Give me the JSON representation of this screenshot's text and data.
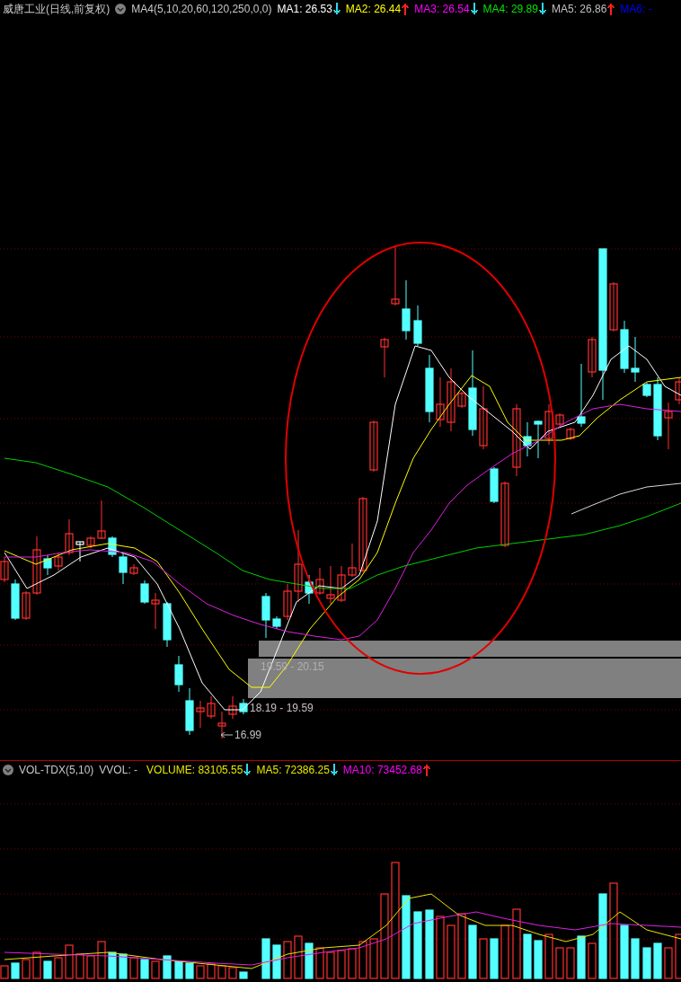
{
  "header": {
    "title": "威唐工业(日线,前复权)",
    "indicator": "MA4(5,10,20,60,120,250,0,0)",
    "ma_items": [
      {
        "label": "MA1: 26.53",
        "color": "#ffffff",
        "arrow": {
          "rising": false,
          "color": "#30d8e8"
        }
      },
      {
        "label": "MA2: 26.44",
        "color": "#ffff00",
        "arrow": {
          "rising": true,
          "color": "#ff2020"
        }
      },
      {
        "label": "MA3: 26.54",
        "color": "#ff00ff",
        "arrow": {
          "rising": false,
          "color": "#30d8e8"
        }
      },
      {
        "label": "MA4: 29.89",
        "color": "#00e600",
        "arrow": {
          "rising": false,
          "color": "#30d8e8"
        }
      },
      {
        "label": "MA5: 26.86",
        "color": "#c0c0c0",
        "arrow": {
          "rising": true,
          "color": "#ff2020"
        }
      },
      {
        "label": "MA6: -",
        "color": "#0000ff"
      }
    ]
  },
  "price_labels": {
    "upper_zone": "19.59 - 20.15",
    "lower_zone": "18.19 - 19.59",
    "low_mark": "16.99"
  },
  "volume_header": {
    "indicator": "VOL-TDX(5,10)",
    "vvol": "VVOL: -",
    "items": [
      {
        "label": "VOLUME: 83105.55",
        "color": "#e6e600",
        "arrow": {
          "rising": false,
          "color": "#30d8e8"
        }
      },
      {
        "label": "MA5: 72386.25",
        "color": "#e6e600",
        "arrow": {
          "rising": false,
          "color": "#30d8e8"
        }
      },
      {
        "label": "MA10: 73452.68",
        "color": "#ff00ff",
        "arrow": {
          "rising": true,
          "color": "#ff2020"
        }
      }
    ]
  }
}
